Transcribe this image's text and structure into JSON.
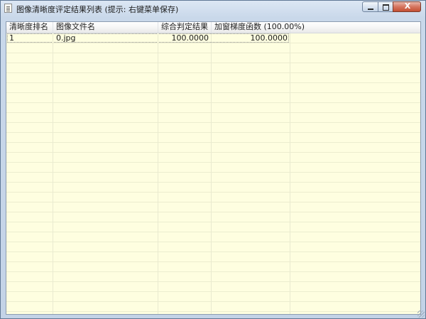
{
  "window": {
    "title": "图像清晰度评定结果列表 (提示: 右键菜单保存)",
    "controls": {
      "minimize": "minimize",
      "maximize": "maximize",
      "close": "X"
    }
  },
  "table": {
    "columns": [
      {
        "label": "清晰度排名"
      },
      {
        "label": "图像文件名"
      },
      {
        "label": "综合判定结果"
      },
      {
        "label": "加窗梯度函数 (100.00%)"
      }
    ],
    "rows": [
      {
        "rank": "1",
        "filename": "0.jpg",
        "overall": "100.0000",
        "windowed_gradient": "100.0000"
      }
    ]
  },
  "colors": {
    "row_background": "#fefee0",
    "title_bar": "#c9d8ea",
    "close_button": "#c45033"
  }
}
